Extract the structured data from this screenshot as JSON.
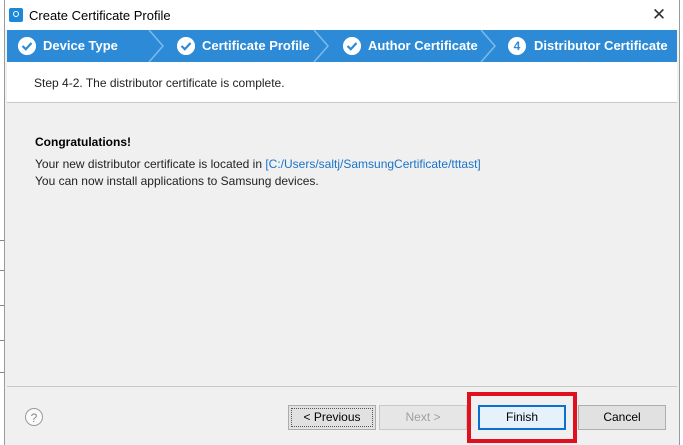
{
  "window": {
    "title": "Create Certificate Profile",
    "close_glyph": "✕"
  },
  "steps": [
    {
      "label": "Device Type",
      "state": "done"
    },
    {
      "label": "Certificate Profile",
      "state": "done"
    },
    {
      "label": "Author Certificate",
      "state": "done"
    },
    {
      "label": "Distributor Certificate",
      "state": "current",
      "number": "4"
    }
  ],
  "header": {
    "step_description": "Step 4-2. The distributor certificate is complete."
  },
  "content": {
    "congrats": "Congratulations!",
    "location_prefix": "Your new distributor certificate is located in ",
    "location_path": "[C:/Users/saltj/SamsungCertificate/tttast]",
    "install_note": "You can now install applications to Samsung devices."
  },
  "footer": {
    "help_glyph": "?",
    "previous_label": "< Previous",
    "next_label": "Next >",
    "finish_label": "Finish",
    "cancel_label": "Cancel"
  },
  "colors": {
    "step_bar": "#2c8ad6",
    "highlight": "#e0101e",
    "link": "#1a73c8"
  }
}
